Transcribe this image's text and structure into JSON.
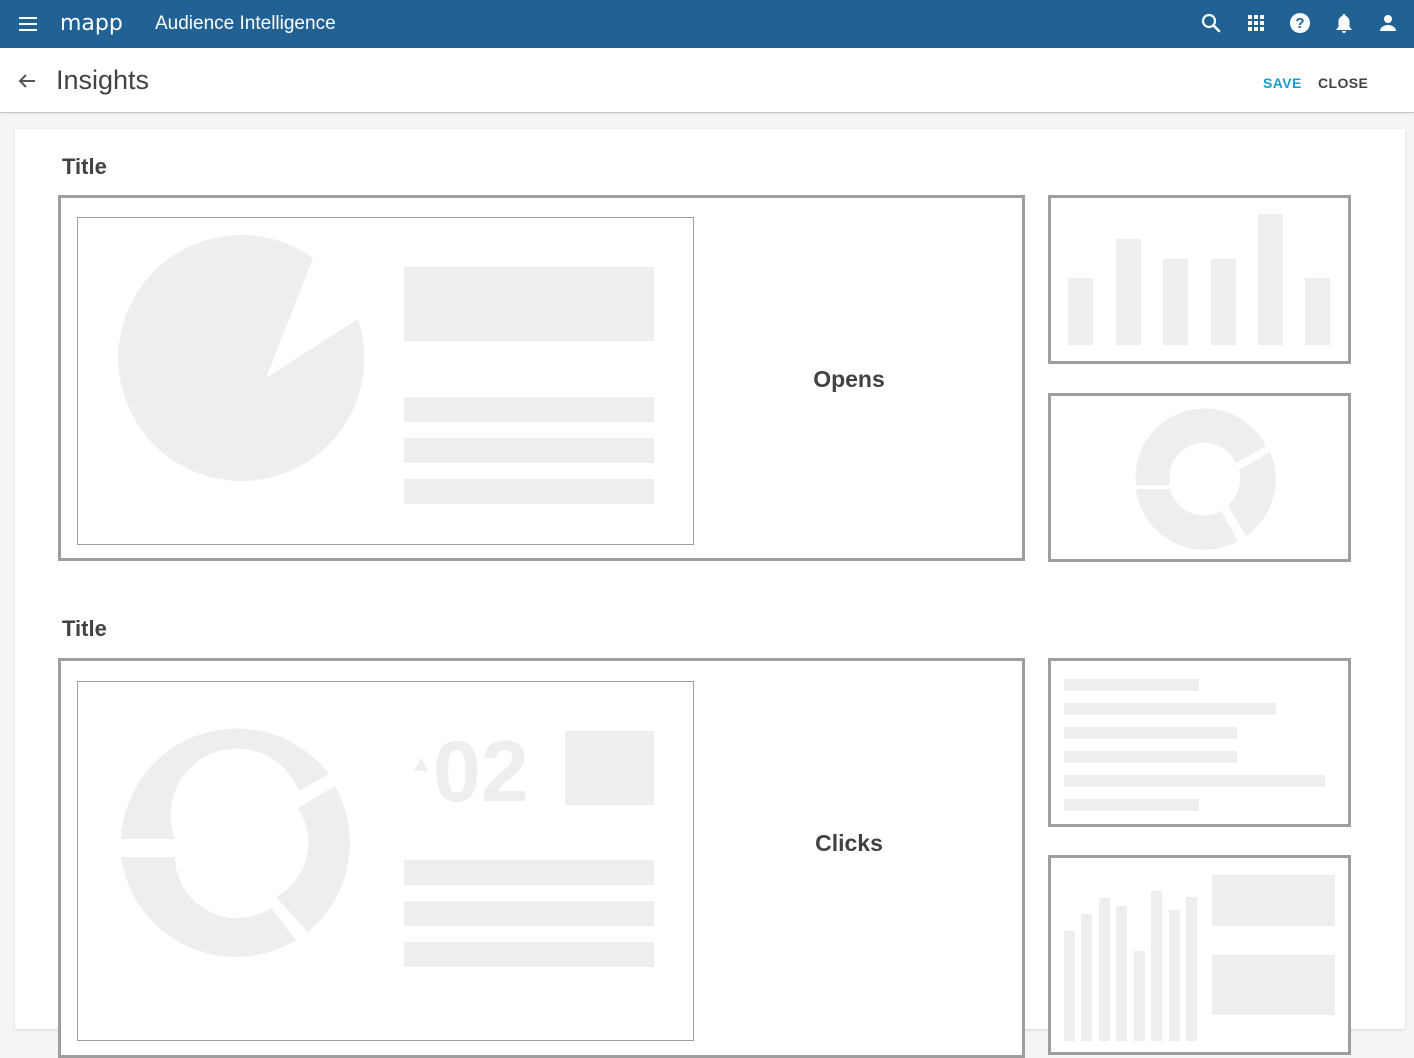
{
  "topbar": {
    "brand": "mapp",
    "app_title": "Audience Intelligence",
    "background": "#216194",
    "icons": [
      "menu-icon",
      "search-icon",
      "apps-grid-icon",
      "help-icon",
      "notifications-bell-icon",
      "account-icon"
    ]
  },
  "subheader": {
    "page_title": "Insights",
    "save_label": "SAVE",
    "close_label": "CLOSE",
    "save_color": "#1a9bd7",
    "close_color": "#424242"
  },
  "sections": [
    {
      "title": "Title",
      "main_widget_label": "Opens"
    },
    {
      "title": "Title",
      "main_widget_label": "Clicks",
      "placeholder_number": "02"
    }
  ],
  "colors": {
    "placeholder": "#eeeeee",
    "widget_border": "#9e9e9e"
  }
}
